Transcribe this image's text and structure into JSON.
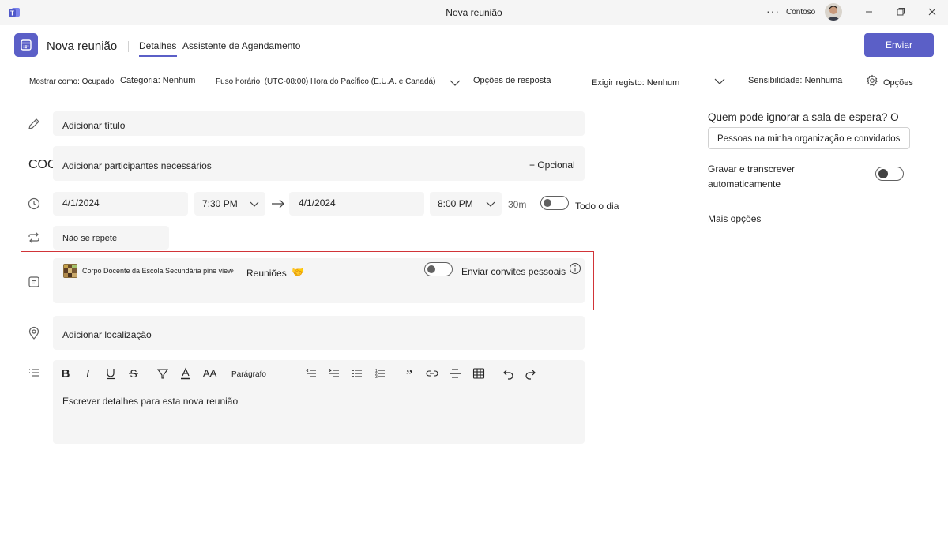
{
  "window": {
    "title": "Nova reunião",
    "org": "Contoso",
    "more": "···"
  },
  "header": {
    "title": "Nova reunião",
    "tabs": [
      {
        "label": "Detalhes",
        "active": true
      },
      {
        "label": "Assistente de Agendamento",
        "active": false
      }
    ],
    "send_label": "Enviar"
  },
  "options_bar": {
    "show_as": "Mostrar como: Ocupado",
    "category": "Categoria: Nenhum",
    "timezone": "Fuso horário: (UTC-08:00) Hora do Pacífico (E.U.A. e Canadá)",
    "response_options": "Opções de resposta",
    "registration": "Exigir registo: Nenhum",
    "sensitivity": "Sensibilidade: Nenhuma",
    "options": "Opções"
  },
  "form": {
    "title_placeholder": "Adicionar título",
    "attendees_prefix": "COO",
    "attendees_placeholder": "Adicionar participantes necessários",
    "optional_label": "+ Opcional",
    "start_date": "4/1/2024",
    "start_time": "7:30 PM",
    "end_date": "4/1/2024",
    "end_time": "8:00 PM",
    "duration": "30m",
    "all_day": "Todo o dia",
    "repeat": "Não se repete",
    "channel": {
      "team": "Corpo Docente da Escola Secundária pine view",
      "separator": "›",
      "name": "Reuniões",
      "emoji": "🤝",
      "invites_label": "Enviar convites pessoais"
    },
    "location_placeholder": "Adicionar localização",
    "editor": {
      "paragraph_label": "Parágrafo",
      "font_size_label": "AA",
      "placeholder": "Escrever detalhes para esta nova reunião"
    }
  },
  "right_panel": {
    "lobby_question": "Quem pode ignorar a sala de espera? O",
    "lobby_value": "Pessoas na minha organização e convidados",
    "record_label_line1": "Gravar e transcrever",
    "record_label_line2": "automaticamente",
    "more_options": "Mais opções"
  },
  "colors": {
    "accent": "#5b5fc7",
    "highlight": "#d13438",
    "field_bg": "#f5f5f5"
  }
}
